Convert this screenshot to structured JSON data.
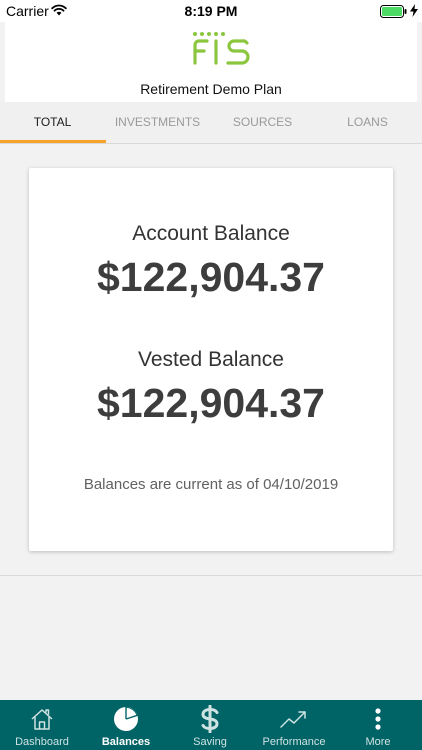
{
  "status_bar": {
    "carrier": "Carrier",
    "time": "8:19 PM"
  },
  "header": {
    "logo_text": "FIS",
    "plan_name": "Retirement Demo Plan"
  },
  "tabs": [
    {
      "label": "TOTAL",
      "active": true
    },
    {
      "label": "INVESTMENTS",
      "active": false
    },
    {
      "label": "SOURCES",
      "active": false
    },
    {
      "label": "LOANS",
      "active": false
    }
  ],
  "card": {
    "account_label": "Account Balance",
    "account_value": "$122,904.37",
    "vested_label": "Vested Balance",
    "vested_value": "$122,904.37",
    "note": "Balances are current as of 04/10/2019"
  },
  "bottom_nav": [
    {
      "label": "Dashboard",
      "icon": "house-icon",
      "active": false
    },
    {
      "label": "Balances",
      "icon": "pie-chart-icon",
      "active": true
    },
    {
      "label": "Saving",
      "icon": "dollar-icon",
      "active": false
    },
    {
      "label": "Performance",
      "icon": "trend-up-icon",
      "active": false
    },
    {
      "label": "More",
      "icon": "vertical-dots-icon",
      "active": false
    }
  ],
  "colors": {
    "accent_orange": "#f6a22b",
    "nav_teal": "#006366",
    "logo_green": "#8cc63f",
    "battery_green": "#4cd964"
  }
}
